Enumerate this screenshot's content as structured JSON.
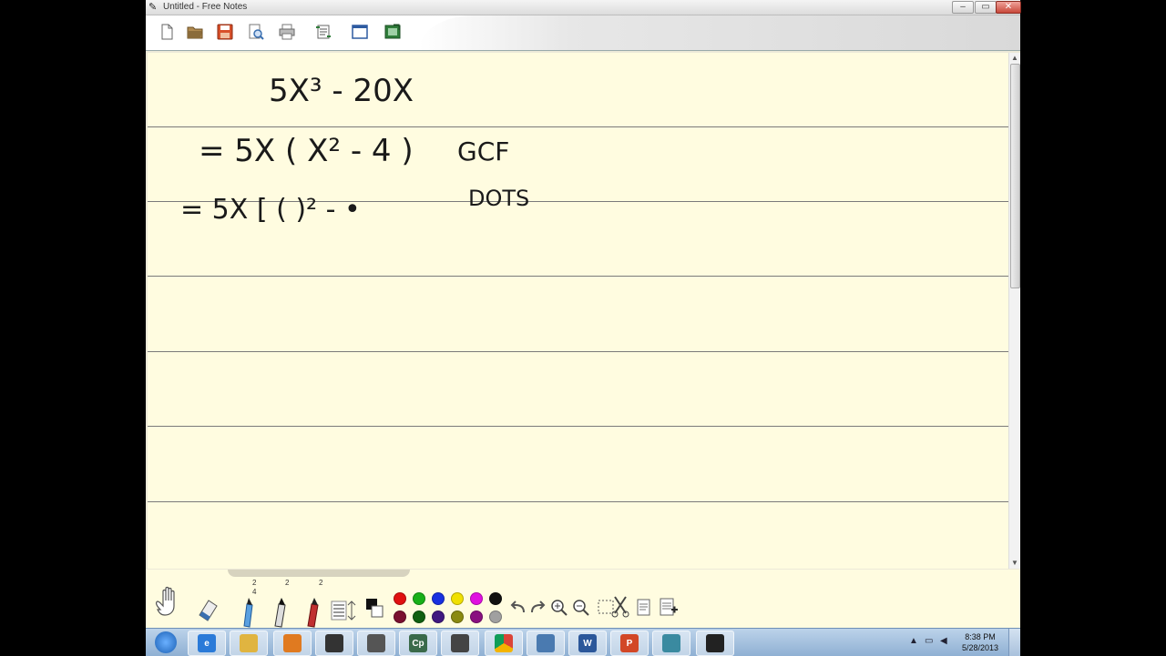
{
  "window": {
    "title": "Untitled - Free Notes",
    "minimize_glyph": "–",
    "maximize_glyph": "▭",
    "close_glyph": "✕"
  },
  "toolbar": {
    "buttons": [
      {
        "name": "new-document-icon",
        "color": "#ffffff"
      },
      {
        "name": "open-folder-icon",
        "color": "#8a6b3a"
      },
      {
        "name": "save-disk-icon",
        "color": "#d8502a"
      },
      {
        "name": "print-preview-icon",
        "color": "#3a6fb0"
      },
      {
        "name": "print-icon",
        "color": "#777777"
      },
      {
        "name": "page-setup-icon",
        "color": "#555555"
      },
      {
        "name": "window-icon",
        "color": "#2d5aa0"
      },
      {
        "name": "export-image-icon",
        "color": "#2f7d3a"
      }
    ]
  },
  "notes": {
    "line1": "5X³ - 20X",
    "line2_expr": "= 5X ( X² - 4 )",
    "line2_note": "GCF",
    "line3_expr": "= 5X [ (   )² - •",
    "line3_note": "DOTS"
  },
  "palette": {
    "pen_sizes": [
      "2",
      "2",
      "2"
    ],
    "pen_sub_label": "4",
    "colors_top": [
      "#e01010",
      "#18b018",
      "#1830e0",
      "#f0e000",
      "#e010e0",
      "#111111"
    ],
    "colors_bottom": [
      "#7a1030",
      "#106010",
      "#401880",
      "#8a8a10",
      "#8a1080",
      "#a0a0a0"
    ]
  },
  "taskbar": {
    "apps": [
      {
        "name": "start-button",
        "label": ""
      },
      {
        "name": "internet-explorer-icon",
        "label": "e"
      },
      {
        "name": "file-explorer-icon",
        "label": ""
      },
      {
        "name": "media-player-icon",
        "label": ""
      },
      {
        "name": "pen-app-icon",
        "label": ""
      },
      {
        "name": "archive-icon",
        "label": ""
      },
      {
        "name": "captivate-icon",
        "label": "Cp"
      },
      {
        "name": "camera-app-icon",
        "label": ""
      },
      {
        "name": "chrome-icon",
        "label": ""
      },
      {
        "name": "network-app-icon",
        "label": ""
      },
      {
        "name": "word-icon",
        "label": "W"
      },
      {
        "name": "powerpoint-icon",
        "label": "P"
      },
      {
        "name": "notes-app-icon",
        "label": ""
      },
      {
        "name": "free-notes-icon",
        "label": ""
      }
    ],
    "time": "8:38 PM",
    "date": "5/28/2013"
  }
}
